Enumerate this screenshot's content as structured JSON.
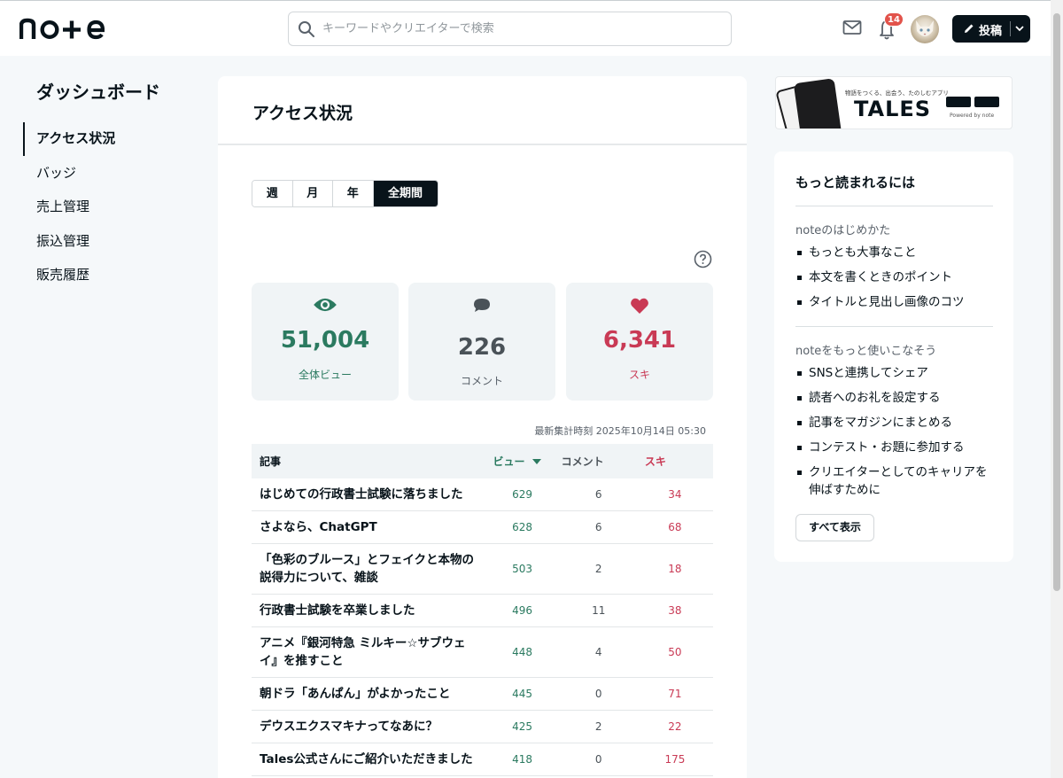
{
  "header": {
    "logo_text": "note",
    "search_placeholder": "キーワードやクリエイターで検索",
    "notification_count": "14",
    "post_label": "投稿"
  },
  "sidebar": {
    "title": "ダッシュボード",
    "items": [
      {
        "label": "アクセス状況",
        "active": true
      },
      {
        "label": "バッジ",
        "active": false
      },
      {
        "label": "売上管理",
        "active": false
      },
      {
        "label": "振込管理",
        "active": false
      },
      {
        "label": "販売履歴",
        "active": false
      }
    ]
  },
  "main": {
    "title": "アクセス状況",
    "periods": [
      {
        "label": "週",
        "selected": false
      },
      {
        "label": "月",
        "selected": false
      },
      {
        "label": "年",
        "selected": false
      },
      {
        "label": "全期間",
        "selected": true
      }
    ],
    "stats": {
      "views": {
        "value": "51,004",
        "label": "全体ビュー",
        "color": "#2b7a60"
      },
      "comments": {
        "value": "226",
        "label": "コメント",
        "color": "#4a5258"
      },
      "likes": {
        "value": "6,341",
        "label": "スキ",
        "color": "#c93a55"
      }
    },
    "updated": "最新集計時刻 2025年10月14日 05:30",
    "table": {
      "headers": {
        "title": "記事",
        "views": "ビュー",
        "comments": "コメント",
        "likes": "スキ"
      },
      "rows": [
        {
          "title": "はじめての行政書士試験に落ちました",
          "views": "629",
          "comments": "6",
          "likes": "34"
        },
        {
          "title": "さよなら、ChatGPT",
          "views": "628",
          "comments": "6",
          "likes": "68"
        },
        {
          "title": "「色彩のブルース」とフェイクと本物の説得力について、雑談",
          "views": "503",
          "comments": "2",
          "likes": "18"
        },
        {
          "title": "行政書士試験を卒業しました",
          "views": "496",
          "comments": "11",
          "likes": "38"
        },
        {
          "title": "アニメ『銀河特急 ミルキー☆サブウェイ』を推すこと",
          "views": "448",
          "comments": "4",
          "likes": "50"
        },
        {
          "title": "朝ドラ「あんぱん」がよかったこと",
          "views": "445",
          "comments": "0",
          "likes": "71"
        },
        {
          "title": "デウスエクスマキナってなあに？",
          "views": "425",
          "comments": "2",
          "likes": "22"
        },
        {
          "title": "Tales公式さんにご紹介いただきました",
          "views": "418",
          "comments": "0",
          "likes": "175"
        }
      ]
    }
  },
  "ad": {
    "tagline": "物語をつくる、出会う、たのしむアプリ",
    "brand": "TALES",
    "powered": "Powered by note"
  },
  "side": {
    "title": "もっと読まれるには",
    "section1_title": "noteのはじめかた",
    "section1_items": [
      "もっとも大事なこと",
      "本文を書くときのポイント",
      "タイトルと見出し画像のコツ"
    ],
    "section2_title": "noteをもっと使いこなそう",
    "section2_items": [
      "SNSと連携してシェア",
      "読者へのお礼を設定する",
      "記事をマガジンにまとめる",
      "コンテスト・お題に参加する",
      "クリエイターとしてのキャリアを伸ばすために"
    ],
    "show_all": "すべて表示"
  }
}
